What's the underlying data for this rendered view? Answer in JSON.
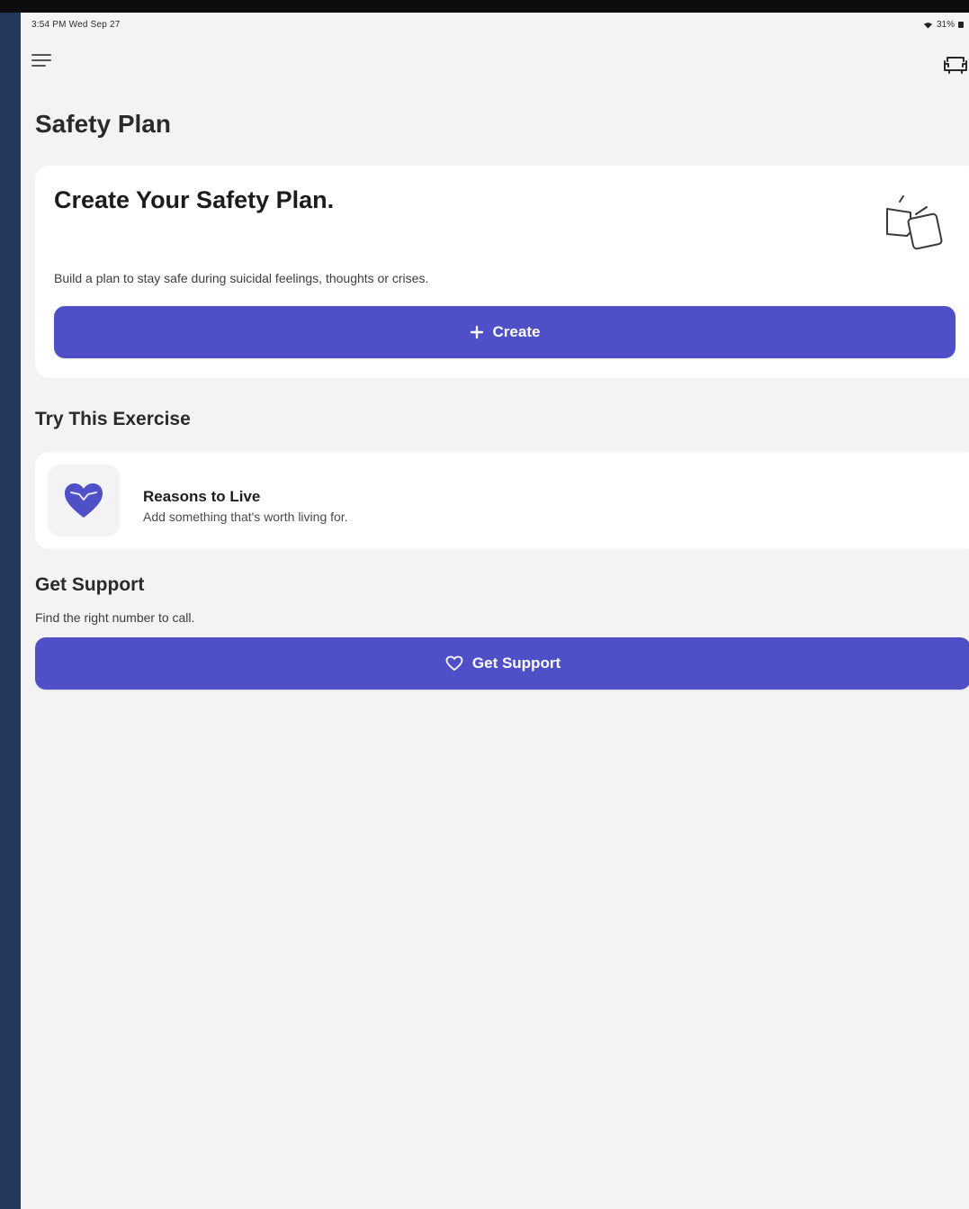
{
  "status_bar": {
    "time_date": "3:54 PM  Wed Sep 27",
    "battery": "31%"
  },
  "header": {
    "menu_icon": "hamburger-menu-icon",
    "right_icon": "sofa-icon"
  },
  "page": {
    "title": "Safety Plan"
  },
  "create_card": {
    "title": "Create Your Safety Plan.",
    "description": "Build a plan to stay safe during suicidal feelings, thoughts or crises.",
    "button_label": "Create",
    "button_icon": "plus-icon",
    "illustration_icon": "cards-icon"
  },
  "exercise_section": {
    "heading": "Try This Exercise",
    "item": {
      "title": "Reasons to Live",
      "subtitle": "Add something that's worth living for.",
      "icon": "heart-icon"
    }
  },
  "support_section": {
    "heading": "Get Support",
    "description": "Find the right number to call.",
    "button_label": "Get Support",
    "button_icon": "heart-outline-icon"
  },
  "colors": {
    "accent": "#4f4fc8",
    "background": "#f3f3f4",
    "card": "#ffffff"
  }
}
